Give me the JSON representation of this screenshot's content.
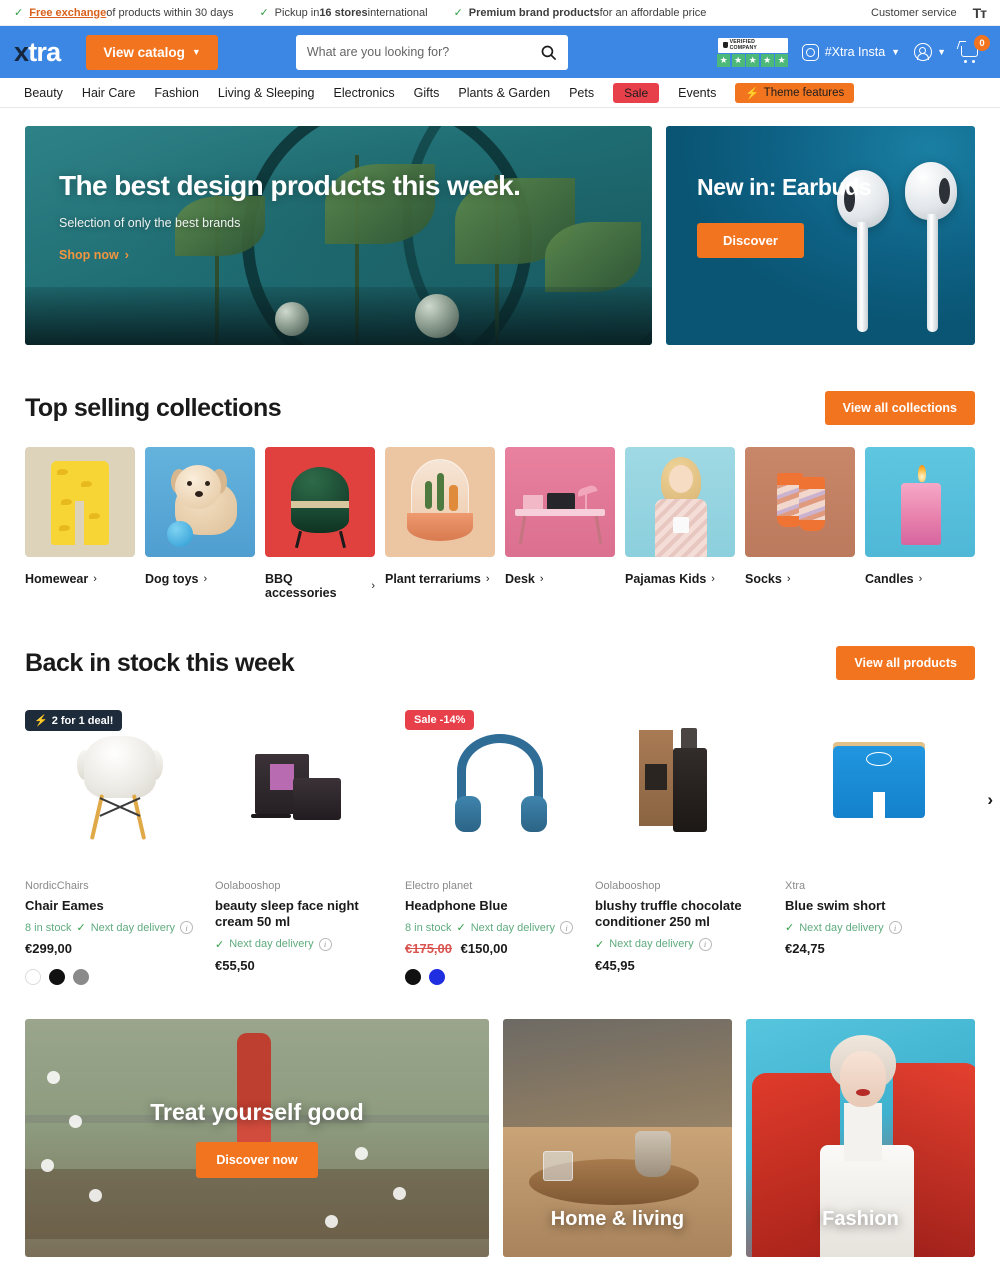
{
  "topbar": {
    "usps": [
      {
        "link": "Free exchange",
        "rest": " of products within 30 days"
      },
      {
        "pre": "Pickup in ",
        "bold": "16 stores",
        "rest": " international"
      },
      {
        "bold": "Premium brand products",
        "rest": " for an affordable price"
      }
    ],
    "customer_service": "Customer service",
    "text_size_icon": "Tт"
  },
  "header": {
    "logo_x": "x",
    "logo_rest": "tra",
    "catalog_label": "View catalog",
    "search_placeholder": "What are you looking for?",
    "search_value": "",
    "verified_label": "VERIFIED COMPANY",
    "stars": 5,
    "instagram_label": "#Xtra Insta",
    "cart_count": "0"
  },
  "nav": {
    "items": [
      {
        "label": "Beauty",
        "style": "plain"
      },
      {
        "label": "Hair Care",
        "style": "plain"
      },
      {
        "label": "Fashion",
        "style": "plain"
      },
      {
        "label": "Living & Sleeping",
        "style": "plain"
      },
      {
        "label": "Electronics",
        "style": "plain"
      },
      {
        "label": "Gifts",
        "style": "plain"
      },
      {
        "label": "Plants & Garden",
        "style": "plain"
      },
      {
        "label": "Pets",
        "style": "plain"
      },
      {
        "label": "Sale",
        "style": "red"
      },
      {
        "label": "Events",
        "style": "plain"
      },
      {
        "label": "Theme features",
        "style": "orange"
      }
    ]
  },
  "hero": {
    "title": "The best design products this week.",
    "subtitle": "Selection of only the best brands",
    "cta": "Shop now",
    "side_title": "New in: Earbuds",
    "side_cta": "Discover"
  },
  "collections_section": {
    "title": "Top selling collections",
    "view_all": "View all collections",
    "items": [
      {
        "label": "Homewear",
        "art": "th-homewear"
      },
      {
        "label": "Dog toys",
        "art": "th-dog"
      },
      {
        "label": "BBQ accessories",
        "art": "th-bbq"
      },
      {
        "label": "Plant terrariums",
        "art": "th-terr"
      },
      {
        "label": "Desk",
        "art": "th-desk"
      },
      {
        "label": "Pajamas Kids",
        "art": "th-pj"
      },
      {
        "label": "Socks",
        "art": "th-socks"
      },
      {
        "label": "Candles",
        "art": "th-candle"
      }
    ]
  },
  "products_section": {
    "title": "Back in stock this week",
    "view_all": "View all products",
    "next_arrow": "›",
    "items": [
      {
        "badge": "2 for 1 deal!",
        "badge_type": "dark",
        "brand": "NordicChairs",
        "name": "Chair Eames",
        "stock": "8 in stock",
        "delivery": "Next day delivery",
        "price": "€299,00",
        "price_old": "",
        "swatches": [
          "#ffffff",
          "#111111",
          "#8a8a8a"
        ]
      },
      {
        "badge": "",
        "badge_type": "",
        "brand": "Oolabooshop",
        "name": "beauty sleep face night cream 50 ml",
        "stock": "",
        "delivery": "Next day delivery",
        "price": "€55,50",
        "price_old": "",
        "swatches": []
      },
      {
        "badge": "Sale -14%",
        "badge_type": "sale",
        "brand": "Electro planet",
        "name": "Headphone Blue",
        "stock": "8 in stock",
        "delivery": "Next day delivery",
        "price": "€150,00",
        "price_old": "€175,00",
        "swatches": [
          "#111111",
          "#1f2ee0"
        ]
      },
      {
        "badge": "",
        "badge_type": "",
        "brand": "Oolabooshop",
        "name": "blushy truffle chocolate conditioner 250 ml",
        "stock": "",
        "delivery": "Next day delivery",
        "price": "€45,95",
        "price_old": "",
        "swatches": []
      },
      {
        "badge": "",
        "badge_type": "",
        "brand": "Xtra",
        "name": "Blue swim short",
        "stock": "",
        "delivery": "Next day delivery",
        "price": "€24,75",
        "price_old": "",
        "swatches": []
      }
    ]
  },
  "promos": [
    {
      "title": "Treat yourself good",
      "cta": "Discover now",
      "position": "center"
    },
    {
      "title": "Home & living",
      "cta": "",
      "position": "bottom"
    },
    {
      "title": "Fashion",
      "cta": "",
      "position": "bottom"
    }
  ],
  "colors": {
    "brand_blue": "#3d87e4",
    "accent_orange": "#f2741f",
    "sale_red": "#e8404a",
    "badge_dark": "#1d2b3a",
    "stock_green": "#5fab7e"
  }
}
